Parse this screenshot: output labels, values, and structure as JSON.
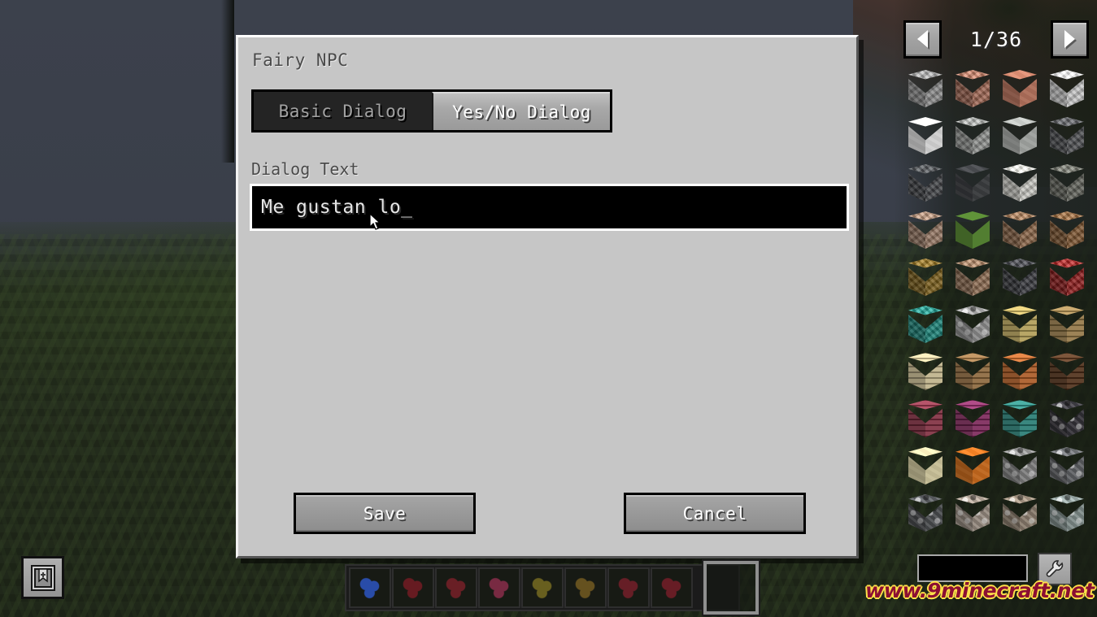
{
  "window": {
    "panel_title": "Fairy NPC"
  },
  "tabs": [
    {
      "label": "Basic Dialog",
      "active": false
    },
    {
      "label": "Yes/No Dialog",
      "active": true
    }
  ],
  "form": {
    "dialog_text_label": "Dialog Text",
    "dialog_text_value": "Me gustan lo",
    "dialog_text_caret": "_",
    "dialog_text_placeholder": ""
  },
  "actions": {
    "save_label": "Save",
    "cancel_label": "Cancel"
  },
  "item_list": {
    "page_indicator": "1/36",
    "prev_icon": "triangle-left-icon",
    "next_icon": "triangle-right-icon",
    "search_value": "",
    "search_placeholder": "",
    "config_icon": "wrench-icon",
    "blocks": [
      {
        "name": "stone",
        "top": "#9e9e9e",
        "style": "noise"
      },
      {
        "name": "granite",
        "top": "#b5745e",
        "style": "noise"
      },
      {
        "name": "polished-granite",
        "top": "#c07a63",
        "style": "smooth"
      },
      {
        "name": "diorite",
        "top": "#e3e3e3",
        "style": "noise"
      },
      {
        "name": "polished-diorite",
        "top": "#e8e8e8",
        "style": "smooth"
      },
      {
        "name": "andesite",
        "top": "#a2a5a2",
        "style": "noise"
      },
      {
        "name": "polished-andesite",
        "top": "#b0b3b0",
        "style": "smooth"
      },
      {
        "name": "deepslate",
        "top": "#56585b",
        "style": "noise"
      },
      {
        "name": "cobbled-deepslate",
        "top": "#4a4c50",
        "style": "noise"
      },
      {
        "name": "polished-deepslate",
        "top": "#3f4144",
        "style": "smooth"
      },
      {
        "name": "calcite",
        "top": "#e4e4de",
        "style": "noise"
      },
      {
        "name": "tuff",
        "top": "#6d6f66",
        "style": "noise"
      },
      {
        "name": "dirt",
        "top": "#a98770",
        "style": "noise"
      },
      {
        "name": "grass-block",
        "top": "#5b8c36",
        "style": "grassy"
      },
      {
        "name": "coarse-dirt",
        "top": "#9c7250",
        "style": "noise"
      },
      {
        "name": "podzol",
        "top": "#8f6138",
        "style": "noise"
      },
      {
        "name": "crimson-nylium",
        "top": "#8a6a1e",
        "style": "noise"
      },
      {
        "name": "rooted-dirt",
        "top": "#a07a5c",
        "style": "noise"
      },
      {
        "name": "bedrock",
        "top": "#3e4045",
        "style": "noise"
      },
      {
        "name": "nether-rack",
        "top": "#a12020",
        "style": "noise"
      },
      {
        "name": "warped-nylium",
        "top": "#1d9387",
        "style": "noise"
      },
      {
        "name": "cobblestone",
        "top": "#9d9d9d",
        "style": "ore"
      },
      {
        "name": "bamboo-planks",
        "top": "#c6b061",
        "style": "planks"
      },
      {
        "name": "oak-planks",
        "top": "#a5864f",
        "style": "planks"
      },
      {
        "name": "birch-planks",
        "top": "#d6c79a",
        "style": "planks"
      },
      {
        "name": "spruce-planks",
        "top": "#9d7444",
        "style": "planks"
      },
      {
        "name": "acacia-planks",
        "top": "#c06529",
        "style": "planks"
      },
      {
        "name": "dark-oak-planks",
        "top": "#59351c",
        "style": "planks"
      },
      {
        "name": "crimson-planks",
        "top": "#8f3347",
        "style": "planks"
      },
      {
        "name": "mangrove-planks",
        "top": "#8a2b63",
        "style": "planks"
      },
      {
        "name": "warped-planks",
        "top": "#2b8a80",
        "style": "planks"
      },
      {
        "name": "blackstone",
        "top": "#3a383e",
        "style": "ore"
      },
      {
        "name": "sandstone",
        "top": "#ddd4a8",
        "style": "smooth"
      },
      {
        "name": "orange-terracotta",
        "top": "#d67220",
        "style": "smooth"
      },
      {
        "name": "coal-ore",
        "top": "#8e8e8e",
        "style": "ore"
      },
      {
        "name": "deepslate-coal-ore",
        "top": "#6a6c70",
        "style": "ore"
      },
      {
        "name": "deepslate-iron-ore",
        "top": "#545659",
        "style": "ore"
      },
      {
        "name": "iron-ore",
        "top": "#a79a8e",
        "style": "ore"
      },
      {
        "name": "copper-ore",
        "top": "#9a8b7a",
        "style": "ore"
      },
      {
        "name": "diamond-ore",
        "top": "#8f9d9b",
        "style": "ore"
      }
    ]
  },
  "hotbar": {
    "recipe_book_icon": "recipe-book-icon",
    "slots": [
      {
        "name": "blue-orchid",
        "color": "#2a4fb0"
      },
      {
        "name": "red-flower-1",
        "color": "#6b1c22"
      },
      {
        "name": "red-flower-2",
        "color": "#6e2026"
      },
      {
        "name": "pink-flower",
        "color": "#7e2b45"
      },
      {
        "name": "yellow-bloom",
        "color": "#6d6320"
      },
      {
        "name": "gold-bloom",
        "color": "#6a5420"
      },
      {
        "name": "red-flower-3",
        "color": "#6b1f28"
      },
      {
        "name": "red-flower-4",
        "color": "#6c1e26"
      }
    ],
    "selected_index": 8
  },
  "watermark": {
    "text": "www.9minecraft.net"
  },
  "cursor": {
    "icon": "mouse-pointer-icon"
  }
}
